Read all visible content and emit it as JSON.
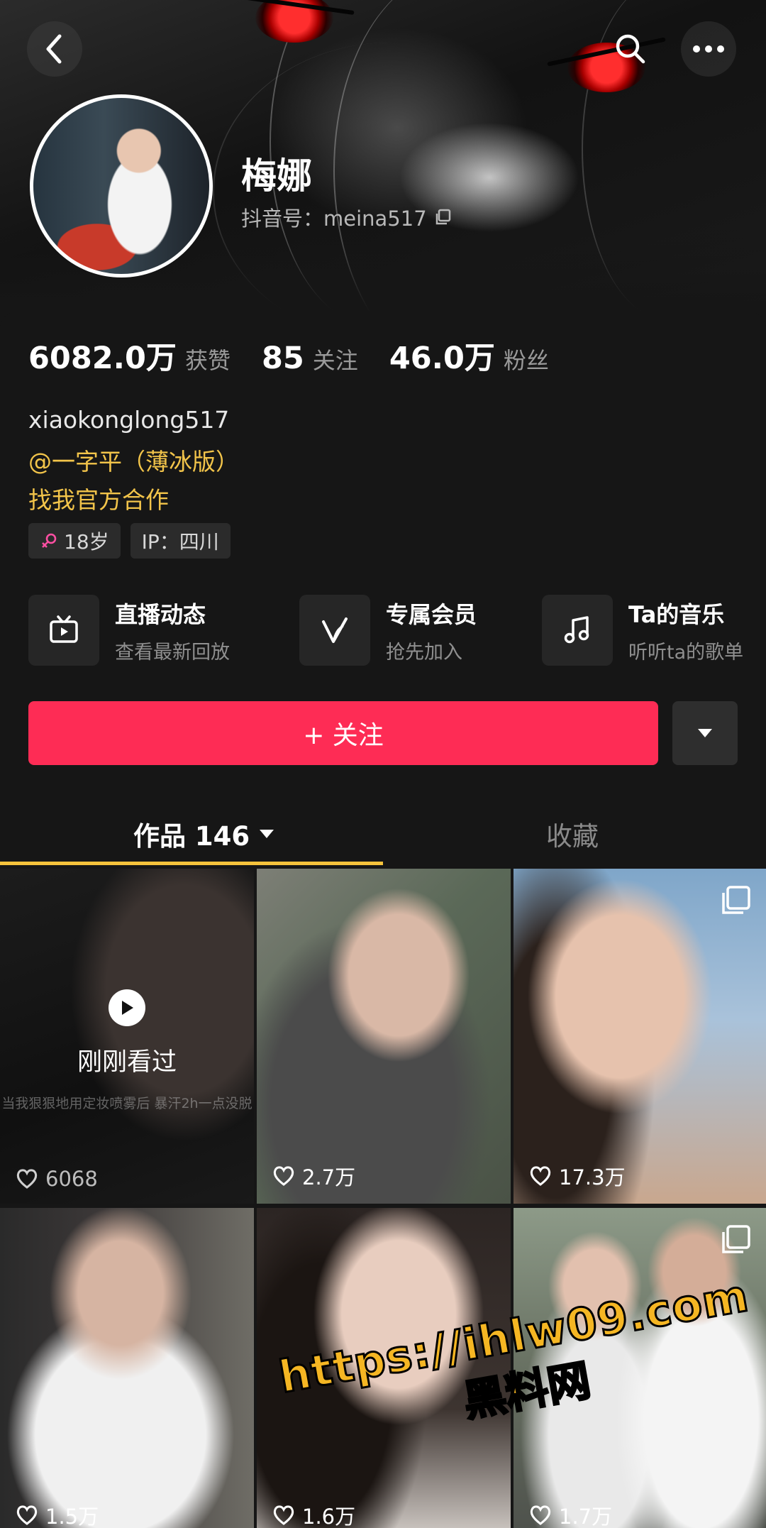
{
  "header": {
    "name": "梅娜",
    "douyin_id": "抖音号：meina517"
  },
  "stats": [
    {
      "value": "6082.0万",
      "label": "获赞"
    },
    {
      "value": "85",
      "label": "关注"
    },
    {
      "value": "46.0万",
      "label": "粉丝"
    }
  ],
  "bio": {
    "line1": "xiaokonglong517",
    "line2": "@一字平（薄冰版）",
    "line3": "找我官方合作"
  },
  "tags": {
    "age": "18岁",
    "ip": "IP：四川"
  },
  "services": [
    {
      "title": "直播动态",
      "subtitle": "查看最新回放",
      "icon": "tv-icon"
    },
    {
      "title": "专属会员",
      "subtitle": "抢先加入",
      "icon": "v-member-icon"
    },
    {
      "title": "Ta的音乐",
      "subtitle": "听听ta的歌单",
      "icon": "music-note-icon"
    }
  ],
  "actions": {
    "follow_label": "+ 关注"
  },
  "tabs": {
    "works_label": "作品 146",
    "favorites_label": "收藏"
  },
  "grid": [
    {
      "likes": "6068",
      "watched_label": "刚刚看过",
      "caption": "当我狠狠地用定妆喷雾后 暴汗2h一点没脱"
    },
    {
      "likes": "2.7万"
    },
    {
      "likes": "17.3万",
      "multi": true
    },
    {
      "likes": "1.5万"
    },
    {
      "likes": "1.6万"
    },
    {
      "likes": "1.7万",
      "multi": true
    }
  ],
  "watermark": {
    "line1": "https://ihlw09.com",
    "line2": "黑料网"
  },
  "colors": {
    "accent_follow": "#fe2c55",
    "tab_underline": "#f6c33c",
    "bio_link": "#f2c44a",
    "background": "#161616"
  }
}
